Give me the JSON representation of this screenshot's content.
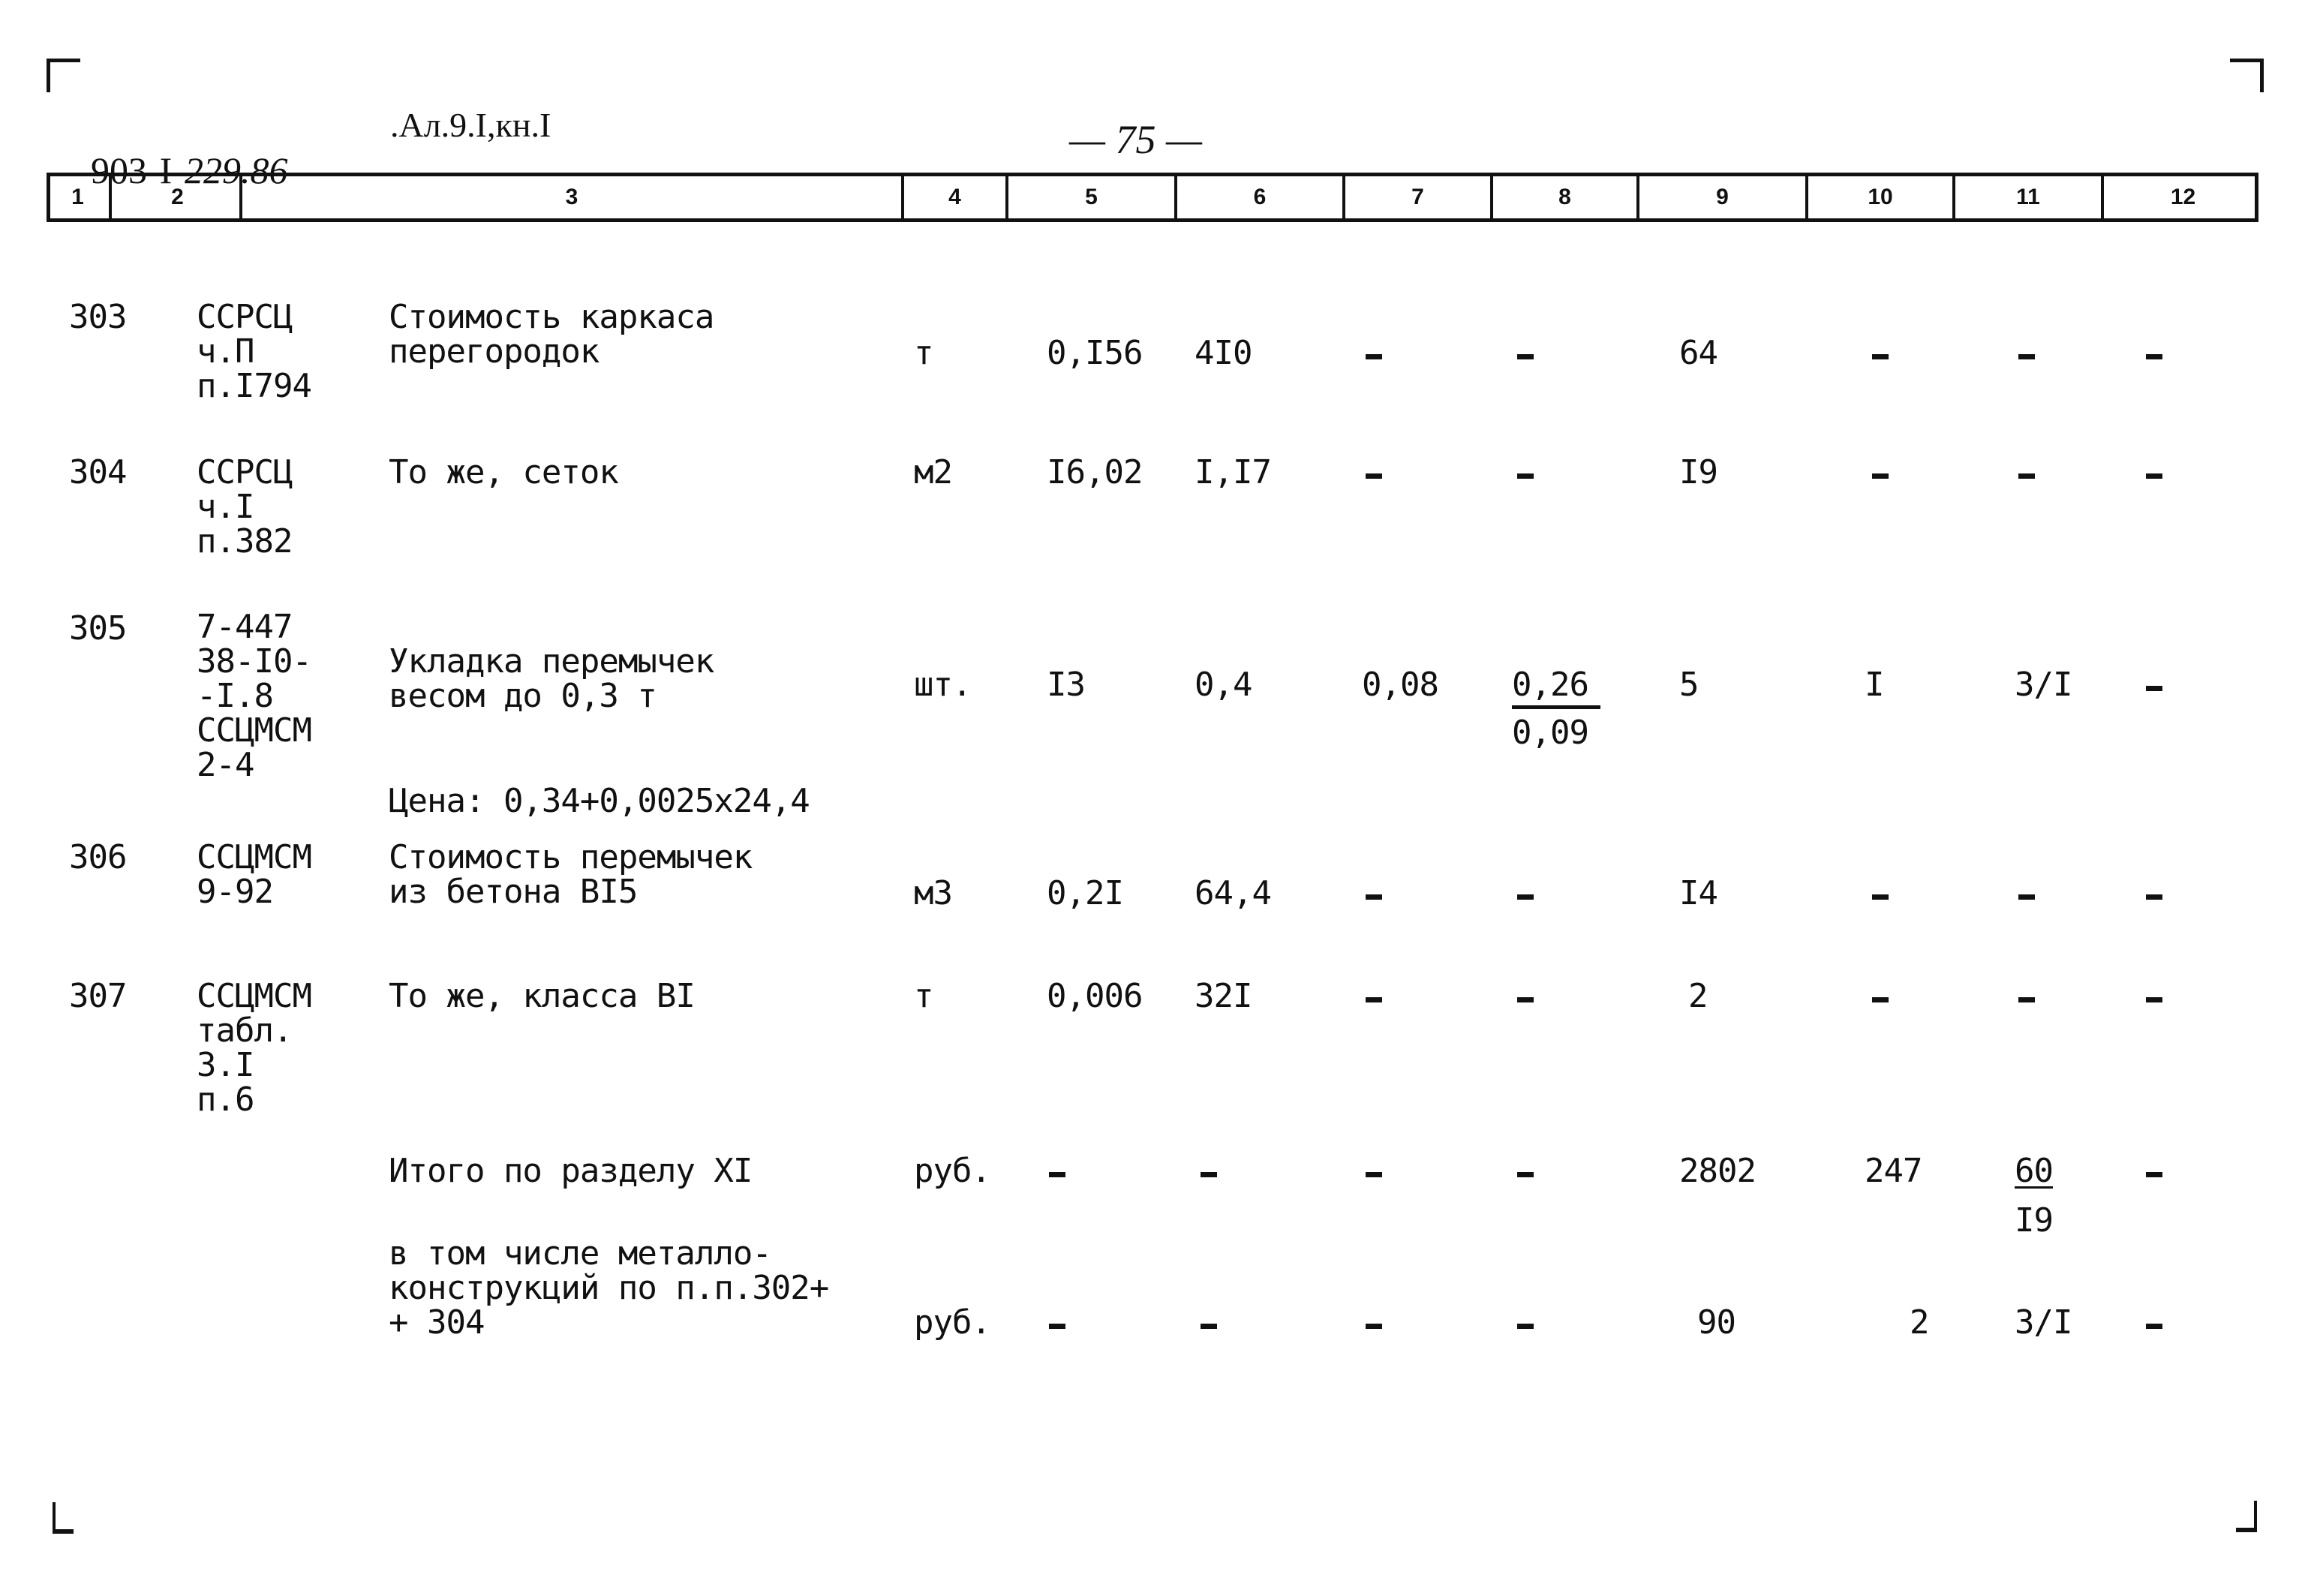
{
  "header": {
    "doc_code_prefix": "903-I-",
    "doc_code_hand": "229.86",
    "doc_ref": ".Ал.9.I,кн.I",
    "page_number": "— 75 —"
  },
  "table": {
    "columns": [
      "1",
      "2",
      "3",
      "4",
      "5",
      "6",
      "7",
      "8",
      "9",
      "10",
      "11",
      "12"
    ],
    "rows": [
      {
        "num": "303",
        "code": [
          "ССРСЦ",
          "ч.П",
          "п.I794"
        ],
        "name": [
          "Стоимость каркаса",
          "перегородок"
        ],
        "unit": "т",
        "c5": "0,I56",
        "c6": "4I0",
        "c7": "-",
        "c8": "-",
        "c9": "64",
        "c10": "-",
        "c11": "-",
        "c12": "-"
      },
      {
        "num": "304",
        "code": [
          "ССРСЦ",
          "ч.I",
          "п.382"
        ],
        "name": [
          "То же, сеток"
        ],
        "unit": "м2",
        "c5": "I6,02",
        "c6": "I,I7",
        "c7": "-",
        "c8": "-",
        "c9": "I9",
        "c10": "-",
        "c11": "-",
        "c12": "-"
      },
      {
        "num": "305",
        "code": [
          "7-447",
          "38-I0-",
          "-I.8",
          "ССЦМСМ",
          "2-4"
        ],
        "name": [
          "Укладка перемычек",
          "весом до 0,3 т"
        ],
        "note": "Цена: 0,34+0,0025x24,4",
        "unit": "шт.",
        "c5": "I3",
        "c6": "0,4",
        "c7": "0,08",
        "c8_top": "0,26",
        "c8_bottom": "0,09",
        "c9": "5",
        "c10": "I",
        "c11": "3/I",
        "c12": "-"
      },
      {
        "num": "306",
        "code": [
          "ССЦМСМ",
          "9-92"
        ],
        "name": [
          "Стоимость перемычек",
          "из бетона BI5"
        ],
        "unit": "м3",
        "c5": "0,2I",
        "c6": "64,4",
        "c7": "-",
        "c8": "-",
        "c9": "I4",
        "c10": "-",
        "c11": "-",
        "c12": "-"
      },
      {
        "num": "307",
        "code": [
          "ССЦМСМ",
          "табл.",
          "3.I",
          "п.6"
        ],
        "name": [
          "То же, класса BI"
        ],
        "unit": "т",
        "c5": "0,006",
        "c6": "32I",
        "c7": "-",
        "c8": "-",
        "c9": "2",
        "c10": "-",
        "c11": "-",
        "c12": "-"
      }
    ],
    "totals": [
      {
        "name": [
          "Итого по разделу XI"
        ],
        "unit": "руб.",
        "c5": "-",
        "c6": "-",
        "c7": "-",
        "c8": "-",
        "c9": "2802",
        "c10": "247",
        "c11_top": "60",
        "c11_bottom": "I9",
        "c12": "-"
      },
      {
        "name": [
          "в том числе металло-",
          "конструкций по п.п.302+",
          "+ 304"
        ],
        "unit": "руб.",
        "c5": "-",
        "c6": "-",
        "c7": "-",
        "c8": "-",
        "c9": "90",
        "c10": "2",
        "c11": "3/I",
        "c12": "-"
      }
    ]
  }
}
